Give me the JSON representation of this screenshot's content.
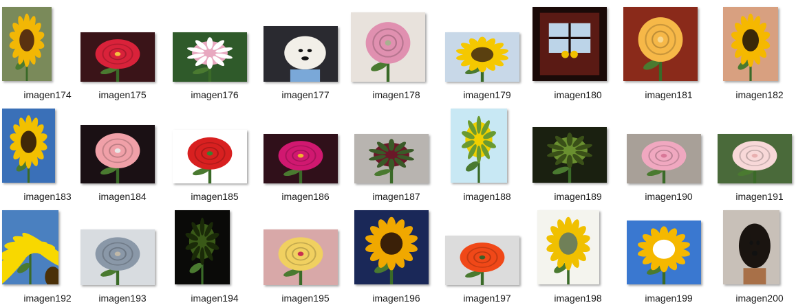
{
  "colors": {
    "background": "#ffffff",
    "label": "#1a1a1a"
  },
  "files": [
    {
      "name": "imagen174",
      "icon": "sunflower-photo-icon",
      "bg": "#7a8a5a",
      "accent": "#f2b705",
      "center": "#5a3210"
    },
    {
      "name": "imagen175",
      "icon": "red-rose-photo-icon",
      "bg": "#3a1418",
      "accent": "#d9223a",
      "center": "#f5c040"
    },
    {
      "name": "imagen176",
      "icon": "pink-rose-bud-photo-icon",
      "bg": "#2f5a2a",
      "accent": "#e8a8c0",
      "center": "#ffffff"
    },
    {
      "name": "imagen177",
      "icon": "white-dog-photo-icon",
      "bg": "#2a2a30",
      "accent": "#f2efe8",
      "center": "#7aa8d8"
    },
    {
      "name": "imagen178",
      "icon": "pink-lisianthus-photo-icon",
      "bg": "#e8e2dc",
      "accent": "#e090b0",
      "center": "#a8b090"
    },
    {
      "name": "imagen179",
      "icon": "sunflower-photo-icon",
      "bg": "#c8d8e8",
      "accent": "#f5c800",
      "center": "#5a4010"
    },
    {
      "name": "imagen180",
      "icon": "window-sunflowers-photo-icon",
      "bg": "#1a0a08",
      "accent": "#5a1a14",
      "center": "#bcd4e8"
    },
    {
      "name": "imagen181",
      "icon": "yellow-rose-photo-icon",
      "bg": "#8a2a1a",
      "accent": "#f6b848",
      "center": "#f8d890"
    },
    {
      "name": "imagen182",
      "icon": "sunflower-sunset-photo-icon",
      "bg": "#d8a080",
      "accent": "#f5b800",
      "center": "#3a2808"
    },
    {
      "name": "imagen183",
      "icon": "sunflower-sky-photo-icon",
      "bg": "#3a70b8",
      "accent": "#f2c000",
      "center": "#402808"
    },
    {
      "name": "imagen184",
      "icon": "pink-rose-framed-photo-icon",
      "bg": "#1a1014",
      "accent": "#f0a0a8",
      "center": "#e8e8e8"
    },
    {
      "name": "imagen185",
      "icon": "red-roses-photo-icon",
      "bg": "#ffffff",
      "accent": "#d82020",
      "center": "#3a8030"
    },
    {
      "name": "imagen186",
      "icon": "magenta-peony-photo-icon",
      "bg": "#30101a",
      "accent": "#d01870",
      "center": "#f0b030"
    },
    {
      "name": "imagen187",
      "icon": "dark-rose-stone-photo-icon",
      "bg": "#b8b4b0",
      "accent": "#6a1828",
      "center": "#3a5a28"
    },
    {
      "name": "imagen188",
      "icon": "sunflower-back-photo-icon",
      "bg": "#c8e8f4",
      "accent": "#f0d000",
      "center": "#6a9a30"
    },
    {
      "name": "imagen189",
      "icon": "sunflower-bud-photo-icon",
      "bg": "#1a2010",
      "accent": "#6a9030",
      "center": "#3a5018"
    },
    {
      "name": "imagen190",
      "icon": "pink-rose-photo-icon",
      "bg": "#a8a098",
      "accent": "#f0a8c0",
      "center": "#d87898"
    },
    {
      "name": "imagen191",
      "icon": "pale-roses-photo-icon",
      "bg": "#4a6a3a",
      "accent": "#f8d8d8",
      "center": "#e8b0b0"
    },
    {
      "name": "imagen192",
      "icon": "sunflower-petals-photo-icon",
      "bg": "#4a80c0",
      "accent": "#f8d800",
      "center": "#4a3008"
    },
    {
      "name": "imagen193",
      "icon": "faded-flowers-photo-icon",
      "bg": "#d8dce0",
      "accent": "#8a98a8",
      "center": "#c0b8a8"
    },
    {
      "name": "imagen194",
      "icon": "dark-sunflower-photo-icon",
      "bg": "#0a0a08",
      "accent": "#3a5a18",
      "center": "#1a2a08"
    },
    {
      "name": "imagen195",
      "icon": "roses-bouquet-photo-icon",
      "bg": "#d8a8a8",
      "accent": "#f0d060",
      "center": "#c83050"
    },
    {
      "name": "imagen196",
      "icon": "sunflowers-sky-photo-icon",
      "bg": "#1a2858",
      "accent": "#f0a800",
      "center": "#3a2008"
    },
    {
      "name": "imagen197",
      "icon": "orange-rose-photo-icon",
      "bg": "#dcdcdc",
      "accent": "#f04818",
      "center": "#3a6028"
    },
    {
      "name": "imagen198",
      "icon": "sunflowers-car-photo-icon",
      "bg": "#f4f4ee",
      "accent": "#f0c000",
      "center": "#708058"
    },
    {
      "name": "imagen199",
      "icon": "sunflower-blue-sky-photo-icon",
      "bg": "#3a78d0",
      "accent": "#f5b800",
      "center": "#ffffff"
    },
    {
      "name": "imagen200",
      "icon": "puppy-photo-icon",
      "bg": "#c8c0b8",
      "accent": "#1a1410",
      "center": "#a87048"
    }
  ]
}
